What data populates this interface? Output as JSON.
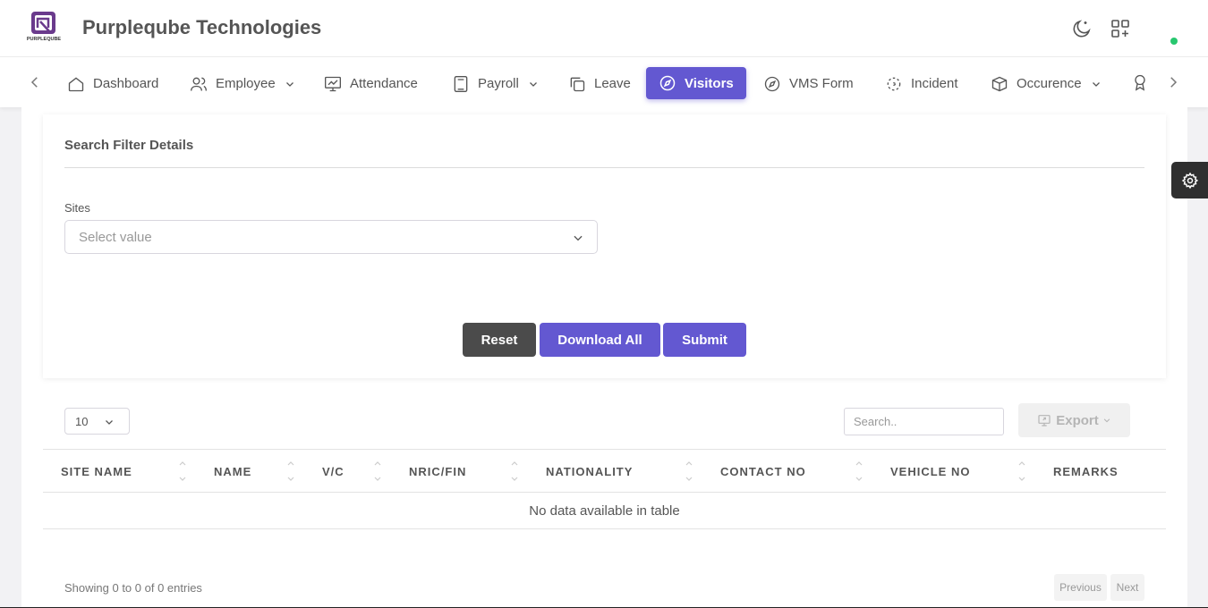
{
  "header": {
    "company_name": "Purpleqube Technologies",
    "logo_text": "PURPLEQUBE"
  },
  "nav": {
    "items": [
      {
        "label": "Dashboard",
        "icon": "home-icon"
      },
      {
        "label": "Employee",
        "icon": "users-icon",
        "dropdown": true
      },
      {
        "label": "Attendance",
        "icon": "presentation-icon"
      },
      {
        "label": "Payroll",
        "icon": "calculator-icon",
        "dropdown": true
      },
      {
        "label": "Leave",
        "icon": "copy-icon"
      },
      {
        "label": "Visitors",
        "icon": "compass-icon",
        "active": true
      },
      {
        "label": "VMS Form",
        "icon": "compass-icon"
      },
      {
        "label": "Incident",
        "icon": "focus-icon"
      },
      {
        "label": "Occurence",
        "icon": "package-icon",
        "dropdown": true
      }
    ]
  },
  "filter": {
    "title": "Search Filter Details",
    "sites_label": "Sites",
    "sites_placeholder": "Select value",
    "reset_label": "Reset",
    "download_label": "Download All",
    "submit_label": "Submit"
  },
  "table": {
    "page_length": "10",
    "search_placeholder": "Search..",
    "export_label": "Export",
    "columns": [
      "SITE NAME",
      "NAME",
      "V/C",
      "NRIC/FIN",
      "NATIONALITY",
      "CONTACT NO",
      "VEHICLE NO",
      "REMARKS"
    ],
    "empty_message": "No data available in table",
    "info": "Showing 0 to 0 of 0 entries",
    "prev_label": "Previous",
    "next_label": "Next"
  },
  "colors": {
    "primary": "#6358d1",
    "dark_button": "#4b4b4b",
    "status_online": "#28c76f"
  }
}
